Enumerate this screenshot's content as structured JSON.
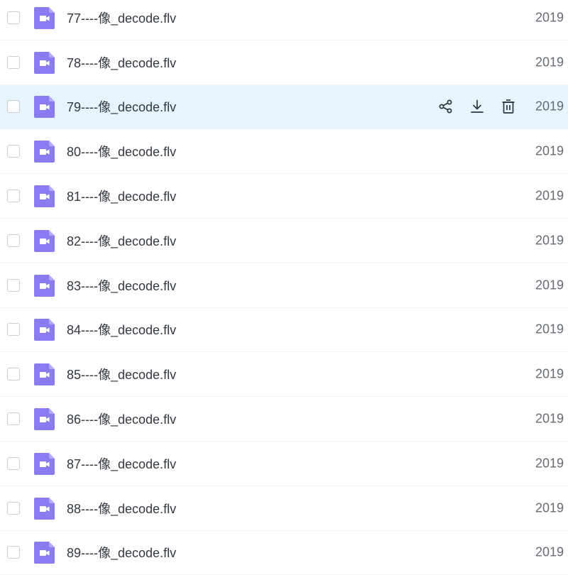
{
  "files": [
    {
      "name": "77----像_decode.flv",
      "date": "2019",
      "icon": "video-file-icon",
      "selected": false
    },
    {
      "name": "78----像_decode.flv",
      "date": "2019",
      "icon": "video-file-icon",
      "selected": false
    },
    {
      "name": "79----像_decode.flv",
      "date": "2019",
      "icon": "video-file-icon",
      "selected": true
    },
    {
      "name": "80----像_decode.flv",
      "date": "2019",
      "icon": "video-file-icon",
      "selected": false
    },
    {
      "name": "81----像_decode.flv",
      "date": "2019",
      "icon": "video-file-icon",
      "selected": false
    },
    {
      "name": "82----像_decode.flv",
      "date": "2019",
      "icon": "video-file-icon",
      "selected": false
    },
    {
      "name": "83----像_decode.flv",
      "date": "2019",
      "icon": "video-file-icon",
      "selected": false
    },
    {
      "name": "84----像_decode.flv",
      "date": "2019",
      "icon": "video-file-icon",
      "selected": false
    },
    {
      "name": "85----像_decode.flv",
      "date": "2019",
      "icon": "video-file-icon",
      "selected": false
    },
    {
      "name": "86----像_decode.flv",
      "date": "2019",
      "icon": "video-file-icon",
      "selected": false
    },
    {
      "name": "87----像_decode.flv",
      "date": "2019",
      "icon": "video-file-icon",
      "selected": false
    },
    {
      "name": "88----像_decode.flv",
      "date": "2019",
      "icon": "video-file-icon",
      "selected": false
    },
    {
      "name": "89----像_decode.flv",
      "date": "2019",
      "icon": "video-file-icon",
      "selected": false
    }
  ],
  "hover_actions": [
    "share-icon",
    "download-icon",
    "delete-icon"
  ],
  "colors": {
    "icon_purple": "#8a7cf0",
    "selected_row_bg": "#e6f4fd",
    "text": "#333840",
    "date_text": "#666b73",
    "action_icon": "#2c3440"
  }
}
